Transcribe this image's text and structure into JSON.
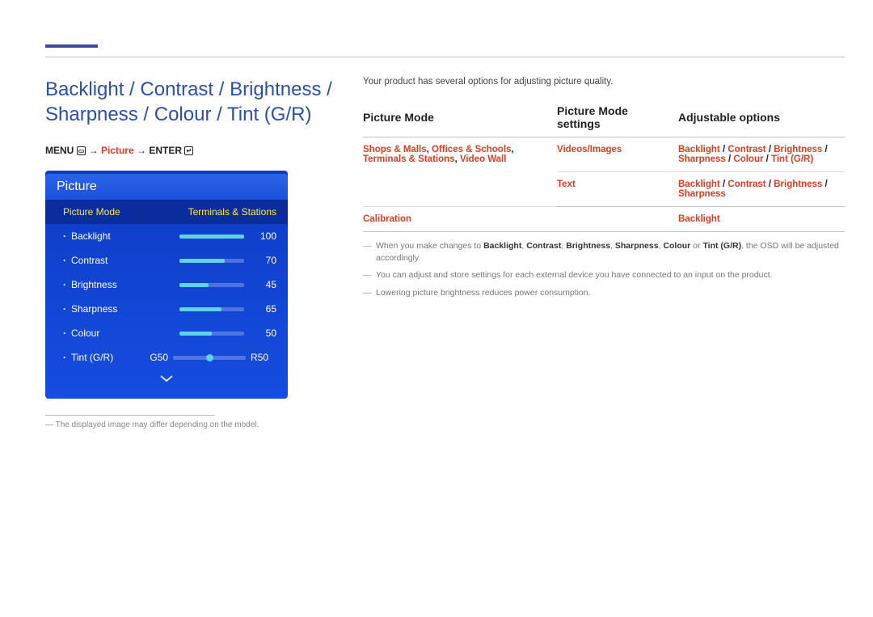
{
  "header": {
    "title": "Backlight / Contrast / Brightness / Sharpness / Colour / Tint (G/R)"
  },
  "menu_path": {
    "menu": "MENU",
    "arrow": " → ",
    "picture": "Picture",
    "enter": "ENTER"
  },
  "osd": {
    "title": "Picture",
    "mode_label": "Picture Mode",
    "mode_value": "Terminals & Stations",
    "items": [
      {
        "label": "Backlight",
        "value": 100,
        "pct": 100
      },
      {
        "label": "Contrast",
        "value": 70,
        "pct": 70
      },
      {
        "label": "Brightness",
        "value": 45,
        "pct": 45
      },
      {
        "label": "Sharpness",
        "value": 65,
        "pct": 65
      },
      {
        "label": "Colour",
        "value": 50,
        "pct": 50
      }
    ],
    "tint": {
      "label": "Tint (G/R)",
      "g": "G50",
      "r": "R50",
      "pos": 50
    }
  },
  "foot_note": "The displayed image may differ depending on the model.",
  "right": {
    "intro": "Your product has several options for adjusting picture quality.",
    "headers": {
      "c1": "Picture Mode",
      "c2": "Picture Mode settings",
      "c3": "Adjustable options"
    },
    "rows": [
      {
        "c1_html": "Shops & Malls, Offices & Schools, Terminals & Stations, Video Wall",
        "c2": "Videos/Images",
        "c3": "Backlight / Contrast / Brightness / Sharpness / Colour / Tint (G/R)"
      },
      {
        "c1_html": "",
        "c2": "Text",
        "c3": "Backlight / Contrast / Brightness / Sharpness"
      },
      {
        "c1_html": "Calibration",
        "c2": "",
        "c3": "Backlight"
      }
    ],
    "notes": {
      "n1_pre": "When you make changes to ",
      "n1_terms": "Backlight, Contrast, Brightness, Sharpness, Colour",
      "n1_or": " or ",
      "n1_tint": "Tint (G/R)",
      "n1_post": ", the OSD will be adjusted accordingly.",
      "n2": "You can adjust and store settings for each external device you have connected to an input on the product.",
      "n3": "Lowering picture brightness reduces power consumption."
    }
  }
}
